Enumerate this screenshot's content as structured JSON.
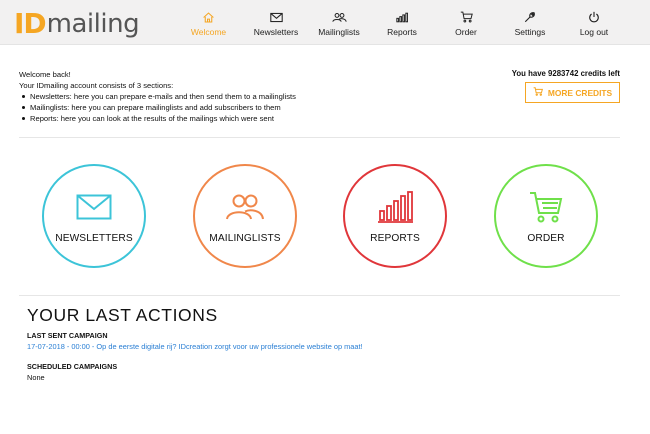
{
  "logo": {
    "id_part": "ID",
    "text_part": "mailing"
  },
  "nav": {
    "items": [
      {
        "key": "welcome",
        "label": "Welcome",
        "icon": "home-icon",
        "active": true
      },
      {
        "key": "newsletters",
        "label": "Newsletters",
        "icon": "envelope-icon",
        "active": false
      },
      {
        "key": "mailinglists",
        "label": "Mailinglists",
        "icon": "users-icon",
        "active": false
      },
      {
        "key": "reports",
        "label": "Reports",
        "icon": "bar-chart-icon",
        "active": false
      },
      {
        "key": "order",
        "label": "Order",
        "icon": "cart-icon",
        "active": false
      },
      {
        "key": "settings",
        "label": "Settings",
        "icon": "wrench-icon",
        "active": false
      },
      {
        "key": "logout",
        "label": "Log out",
        "icon": "power-icon",
        "active": false
      }
    ]
  },
  "intro": {
    "welcome": "Welcome back!",
    "sections": "Your IDmailing account consists of 3 sections:",
    "bullets": [
      "Newsletters: here you can prepare e-mails and then send them to a mailinglists",
      "Mailinglists: here you can prepare mailinglists and add subscribers to them",
      "Reports: here you can look at the results of the mailings which were sent"
    ]
  },
  "credits": {
    "text": "You have 9283742 credits left",
    "button": "MORE CREDITS"
  },
  "tiles": [
    {
      "label": "NEWSLETTERS",
      "icon": "envelope-icon",
      "color": "#3cc4d8"
    },
    {
      "label": "MAILINGLISTS",
      "icon": "users-icon",
      "color": "#f0874a"
    },
    {
      "label": "REPORTS",
      "icon": "bar-chart-icon",
      "color": "#e0363a"
    },
    {
      "label": "ORDER",
      "icon": "cart-icon",
      "color": "#6fe04a"
    }
  ],
  "last_actions": {
    "title": "YOUR LAST ACTIONS",
    "last_sent_heading": "LAST SENT CAMPAIGN",
    "last_sent_link": "17-07-2018 - 00:00 - Op de eerste digitale rij? IDcreation zorgt voor uw professionele website op maat!",
    "scheduled_heading": "SCHEDULED CAMPAIGNS",
    "scheduled_value": "None"
  },
  "colors": {
    "accent": "#f5a623",
    "link": "#2a7fd4",
    "header_bg": "#f2f1f1"
  }
}
